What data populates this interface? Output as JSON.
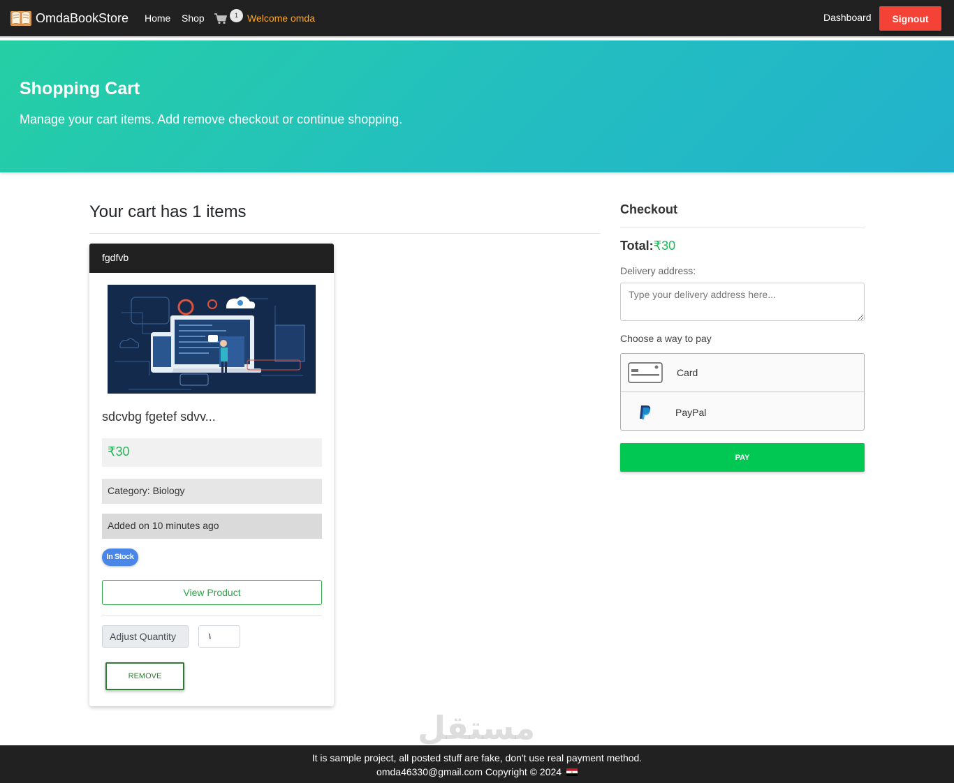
{
  "navbar": {
    "brand": "OmdaBookStore",
    "links": {
      "home": "Home",
      "shop": "Shop"
    },
    "cart_count": "1",
    "welcome": "Welcome omda",
    "dashboard": "Dashboard",
    "signout": "Signout"
  },
  "hero": {
    "title": "Shopping Cart",
    "subtitle": "Manage your cart items. Add remove checkout or continue shopping."
  },
  "cart": {
    "title": "Your cart has 1 items",
    "item": {
      "header": "fgdfvb",
      "title": "sdcvbg fgetef sdvv...",
      "price": "₹30",
      "category": "Category: Biology",
      "added": "Added on 10 minutes ago",
      "stock": "In Stock",
      "view_label": "View Product",
      "adjust_label": "Adjust Quantity",
      "quantity": "١",
      "remove_label": "REMOVE"
    }
  },
  "checkout": {
    "title": "Checkout",
    "total_label": "Total:",
    "total_value": "₹30",
    "address_label": "Delivery address:",
    "address_placeholder": "Type your delivery address here...",
    "pay_label": "Choose a way to pay",
    "options": [
      {
        "label": "Card",
        "icon": "card-icon"
      },
      {
        "label": "PayPal",
        "icon": "paypal-icon"
      }
    ],
    "pay_button": "PAY"
  },
  "footer": {
    "line1": "It is sample project, all posted stuff are fake, don't use real payment method.",
    "line2": "omda46330@gmail.com Copyright © 2024"
  },
  "watermark": "مستقل",
  "colors": {
    "accent_orange": "#ffa723",
    "signout_red": "#f44336",
    "price_green": "#1db954",
    "pay_green": "#00c853",
    "stock_blue": "#4a86e8"
  }
}
